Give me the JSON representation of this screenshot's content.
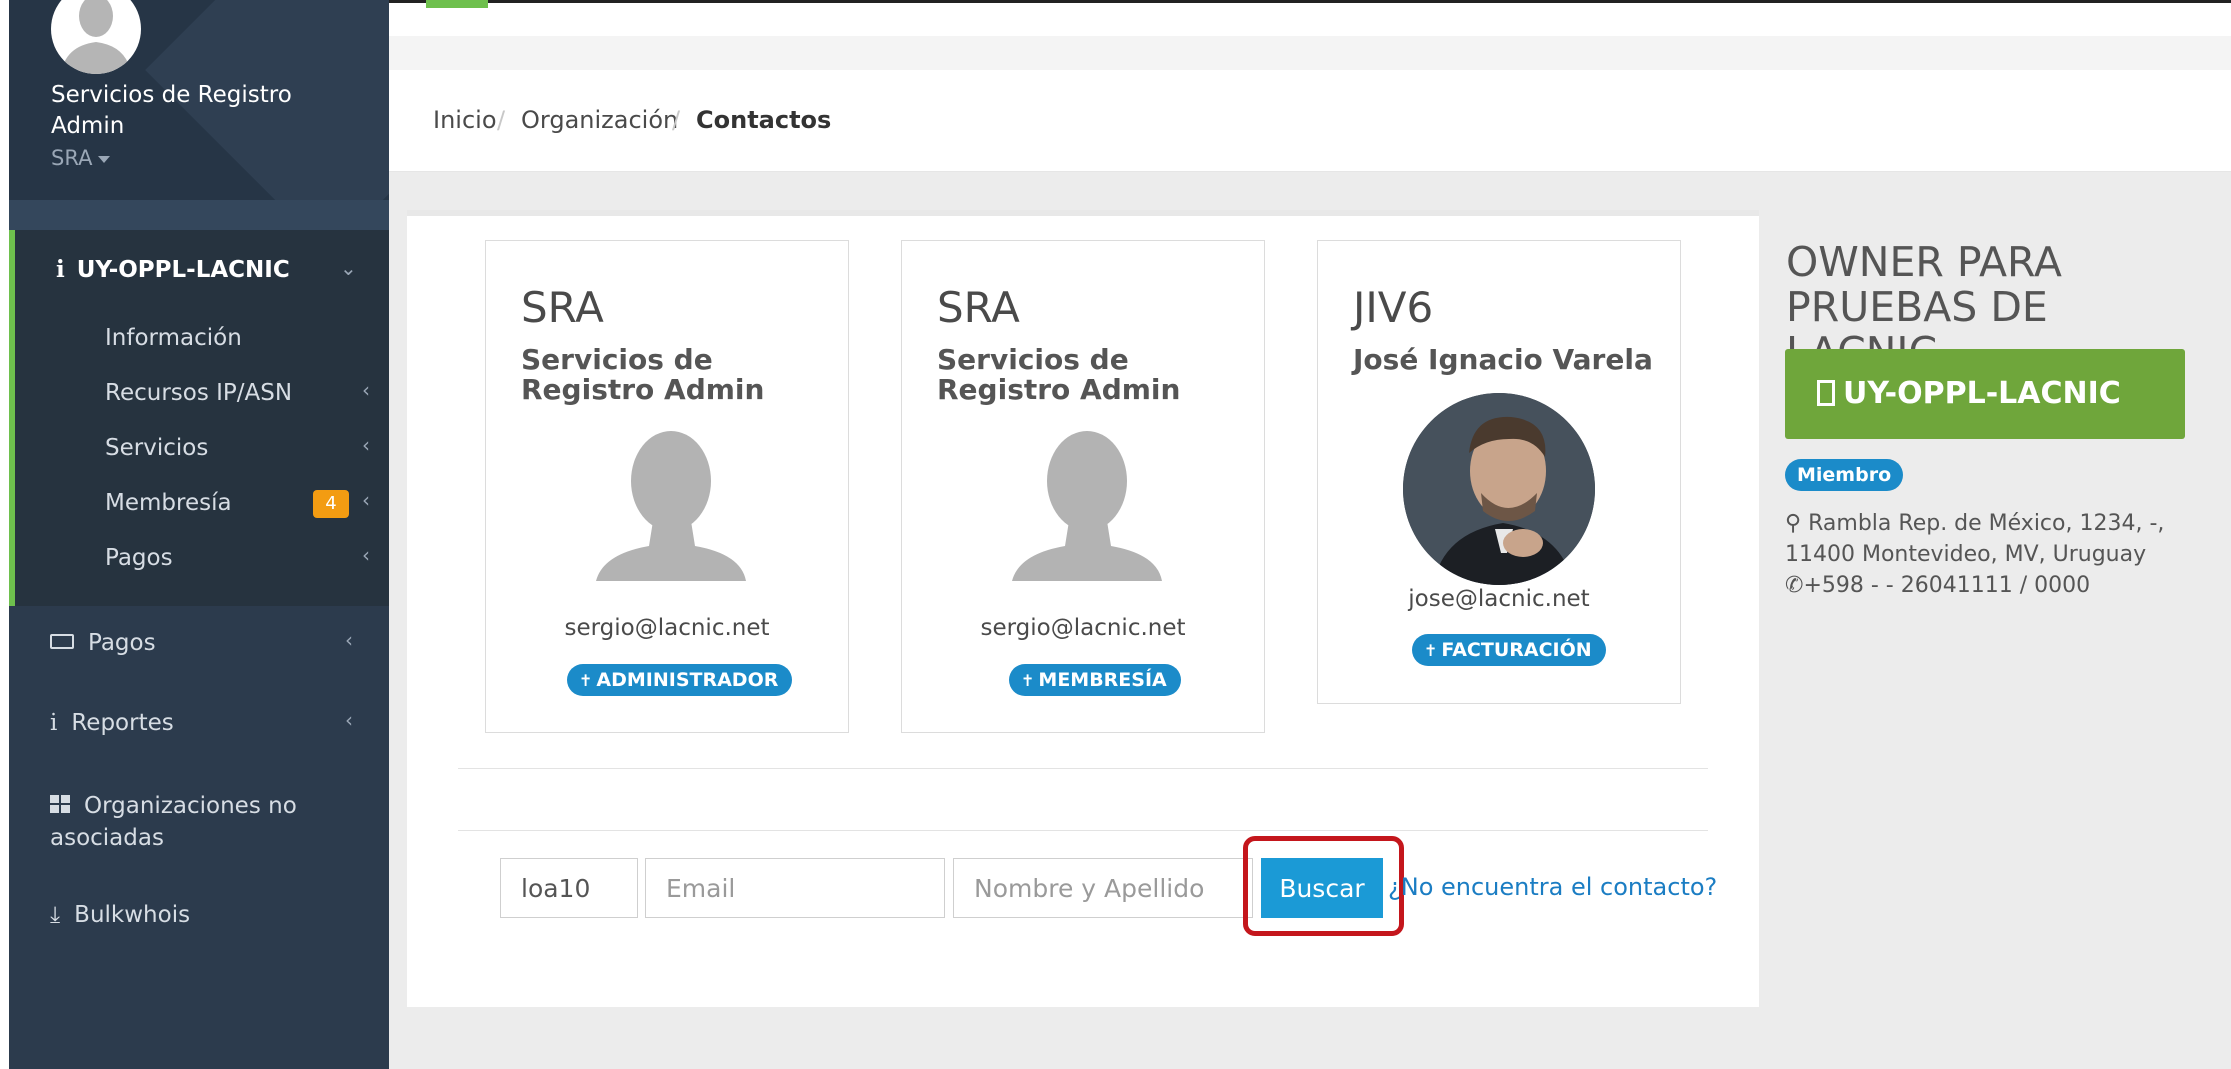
{
  "user": {
    "name": "Servicios de Registro Admin",
    "role": "SRA"
  },
  "sidebar": {
    "org_code": "UY-OPPL-LACNIC",
    "sub_items": [
      {
        "label": "Información"
      },
      {
        "label": "Recursos IP/ASN"
      },
      {
        "label": "Servicios"
      },
      {
        "label": "Membresía",
        "badge": "4"
      },
      {
        "label": "Pagos"
      }
    ],
    "items": [
      {
        "label": "Pagos"
      },
      {
        "label": "Reportes"
      },
      {
        "label": "Organizaciones no asociadas"
      },
      {
        "label": "Bulkwhois"
      }
    ]
  },
  "breadcrumb": {
    "home": "Inicio",
    "org": "Organización",
    "current": "Contactos"
  },
  "contacts": [
    {
      "code": "SRA",
      "name": "Servicios de Registro Admin",
      "email": "sergio@lacnic.net",
      "role": "ADMINISTRADOR"
    },
    {
      "code": "SRA",
      "name": "Servicios de Registro Admin",
      "email": "sergio@lacnic.net",
      "role": "MEMBRESÍA"
    },
    {
      "code": "JIV6",
      "name": "José Ignacio Varela",
      "email": "jose@lacnic.net",
      "role": "FACTURACIÓN"
    }
  ],
  "search": {
    "code_value": "loa10",
    "email_placeholder": "Email",
    "name_placeholder": "Nombre y Apellido",
    "button_label": "Buscar",
    "not_found_link": "¿No encuentra el contacto?"
  },
  "org": {
    "title": "OWNER PARA PRUEBAS DE LACNIC",
    "id": "UY-OPPL-LACNIC",
    "badge": "Miembro",
    "address_line1": "Rambla Rep. de México, 1234, -,",
    "address_line2": "11400 Montevideo, MV, Uruguay",
    "phone": "+598 - - 26041111 / 0000"
  },
  "colors": {
    "sidebar": "#2c3b4d",
    "accent_green": "#6fa63b",
    "badge_blue": "#1b8bc9",
    "button_blue": "#1b9ad6",
    "highlight_red": "#c4161c"
  }
}
